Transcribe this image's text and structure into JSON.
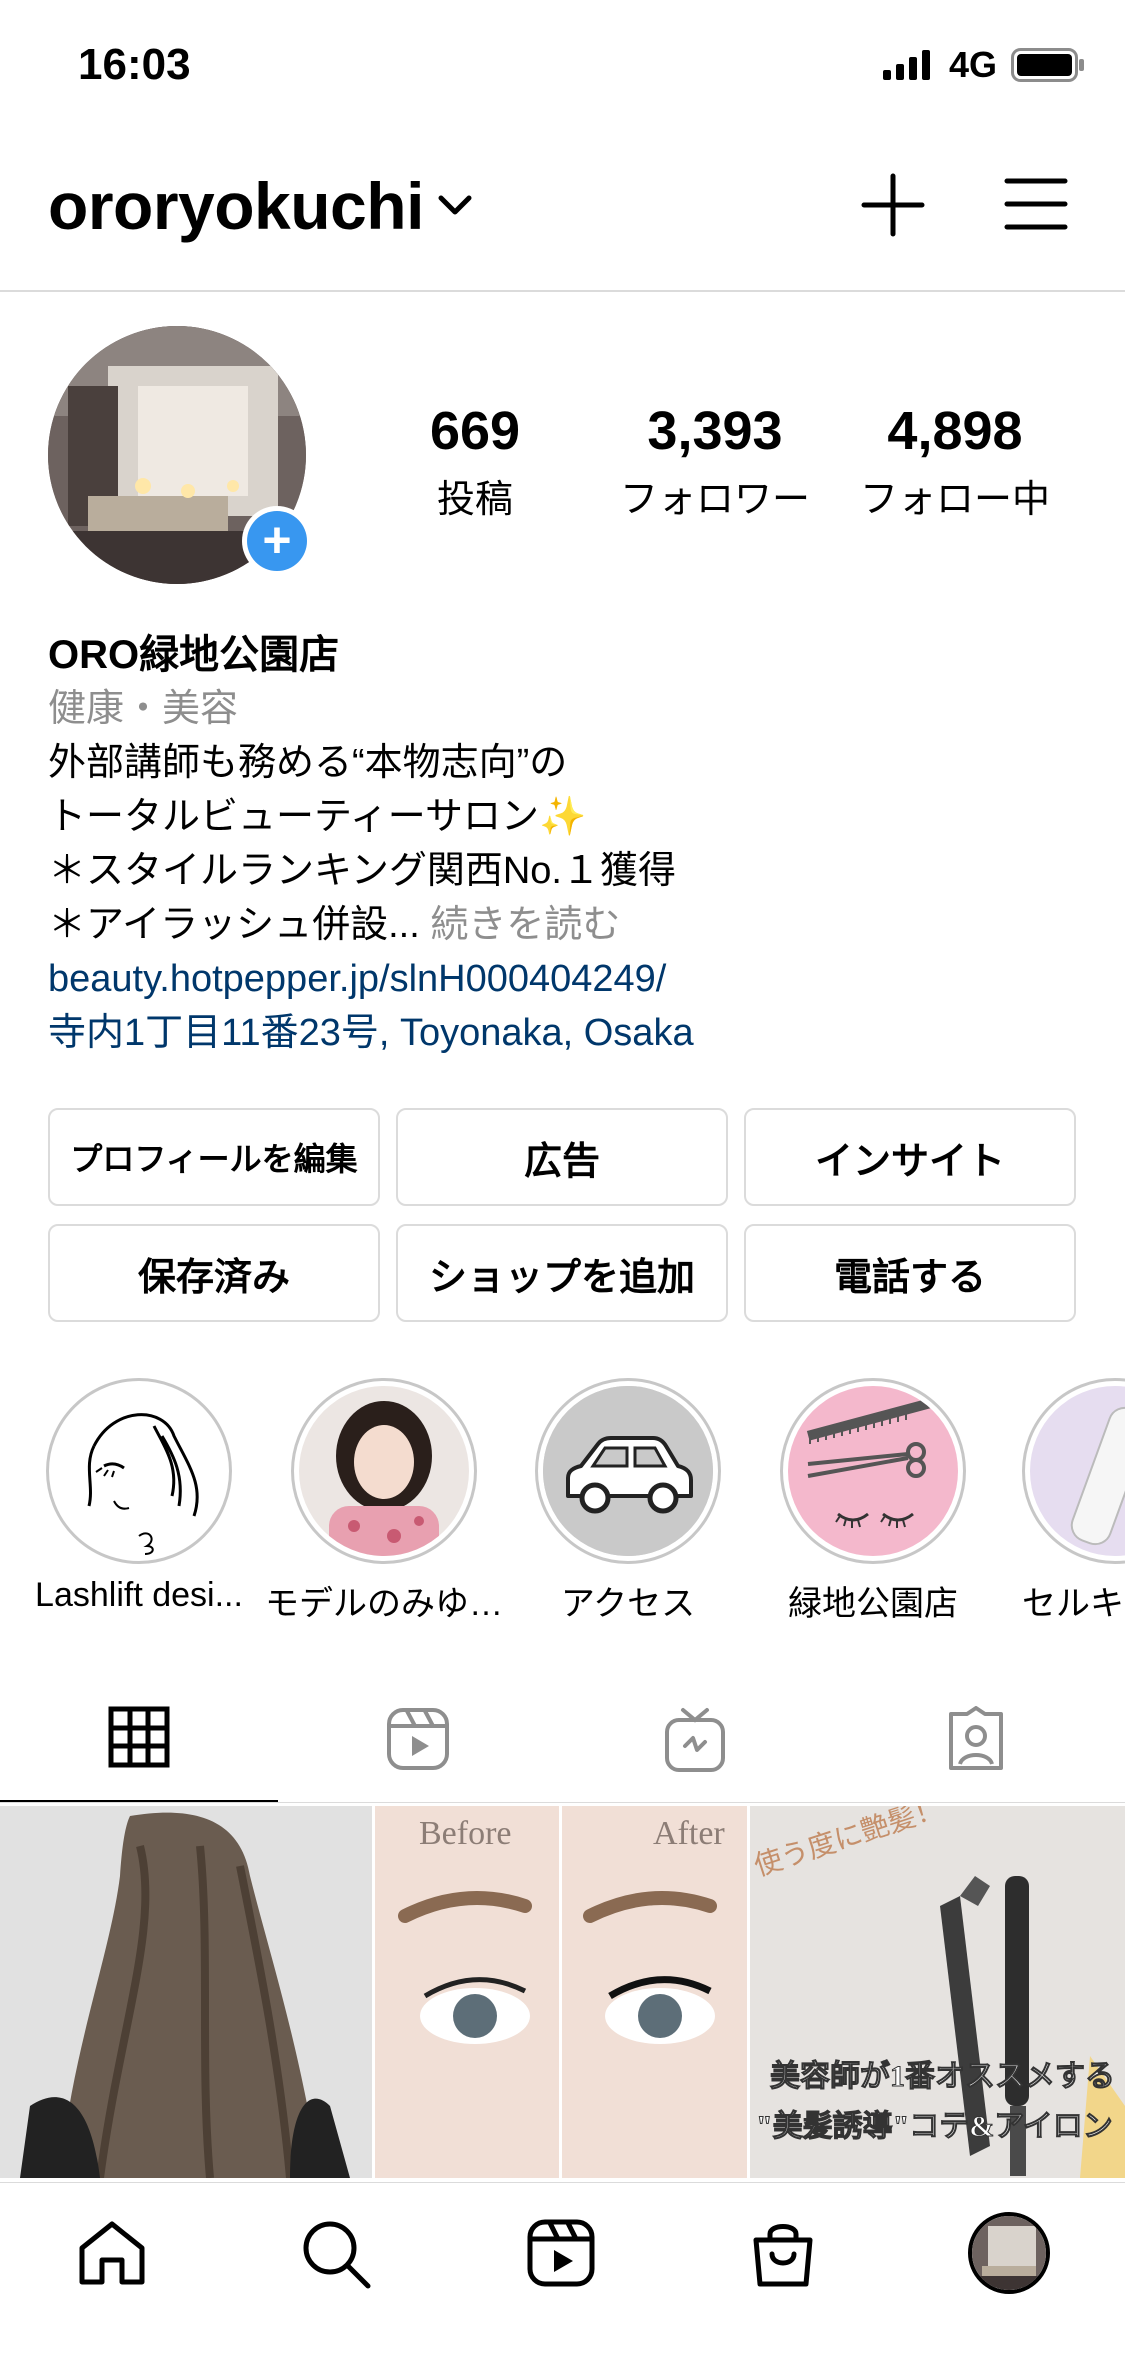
{
  "status_bar": {
    "time": "16:03",
    "network": "4G"
  },
  "header": {
    "username": "ororyokuchi"
  },
  "profile": {
    "stats": [
      {
        "value": "669",
        "label": "投稿"
      },
      {
        "value": "3,393",
        "label": "フォロワー"
      },
      {
        "value": "4,898",
        "label": "フォロー中"
      }
    ],
    "name": "ORO緑地公園店",
    "category": "健康・美容",
    "bio_lines": [
      "外部講師も務める“本物志向”の",
      "トータルビューティーサロン✨",
      "＊スタイルランキング関西No.１獲得"
    ],
    "bio_last": "＊アイラッシュ併設...",
    "more_label": "続きを読む",
    "website": "beauty.hotpepper.jp/slnH000404249/",
    "address": "寺内1丁目11番23号, Toyonaka, Osaka"
  },
  "buttons": {
    "edit_profile": "プロフィールを編集",
    "ads": "広告",
    "insights": "インサイト",
    "saved": "保存済み",
    "add_shop": "ショップを追加",
    "call": "電話する"
  },
  "highlights": [
    {
      "label": "Lashlift desi..."
    },
    {
      "label": "モデルのみゆ…"
    },
    {
      "label": "アクセス"
    },
    {
      "label": "緑地公園店"
    },
    {
      "label": "セルキュ"
    }
  ],
  "grid": {
    "tile2_before": "Before",
    "tile2_after": "After",
    "tile3_top": "使う度に艶髪！",
    "tile3_line1": "美容師が1番オススメする",
    "tile3_line2": "\"美髪誘導\"コテ&アイロン"
  },
  "colors": {
    "accent_blue": "#3897f0",
    "link": "#00376b",
    "divider": "#dbdbdb"
  }
}
